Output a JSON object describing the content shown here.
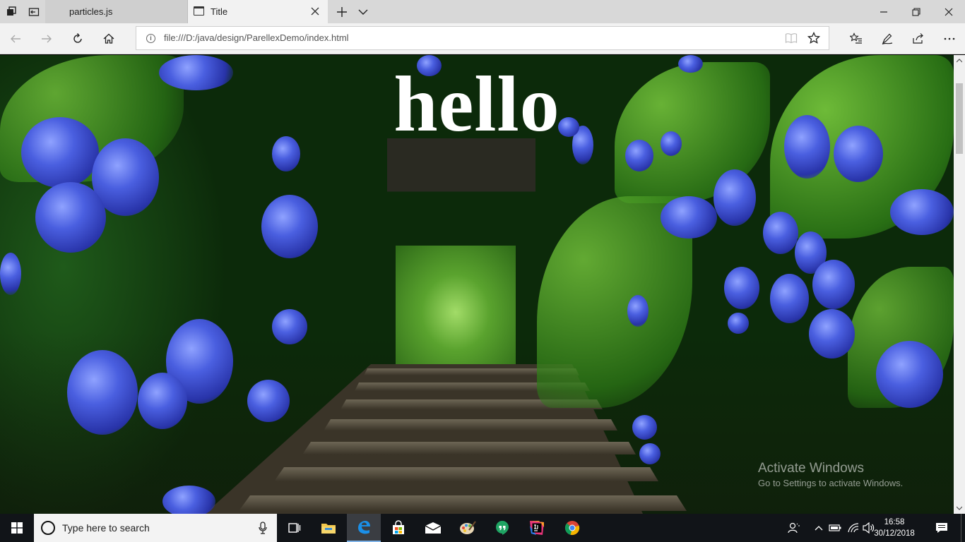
{
  "browser": {
    "tabs": [
      {
        "label": "particles.js",
        "active": false
      },
      {
        "label": "Title",
        "active": true
      }
    ],
    "address": {
      "url": "file:///D:/java/design/ParellexDemo/index.html"
    }
  },
  "page": {
    "heading": "hello"
  },
  "watermark": {
    "title": "Activate Windows",
    "subtitle": "Go to Settings to activate Windows."
  },
  "taskbar": {
    "search_placeholder": "Type here to search",
    "time": "16:58",
    "date": "30/12/2018",
    "pinned": [
      "task-view-icon",
      "file-explorer-icon",
      "edge-icon",
      "store-icon",
      "mail-icon",
      "paint-icon",
      "hangouts-icon",
      "intellij-icon",
      "chrome-icon"
    ]
  },
  "colors": {
    "accent": "#0078d7",
    "titlebar": "#d8d8d8",
    "toolbar": "#f2f2f2",
    "taskbar": "#111418"
  }
}
